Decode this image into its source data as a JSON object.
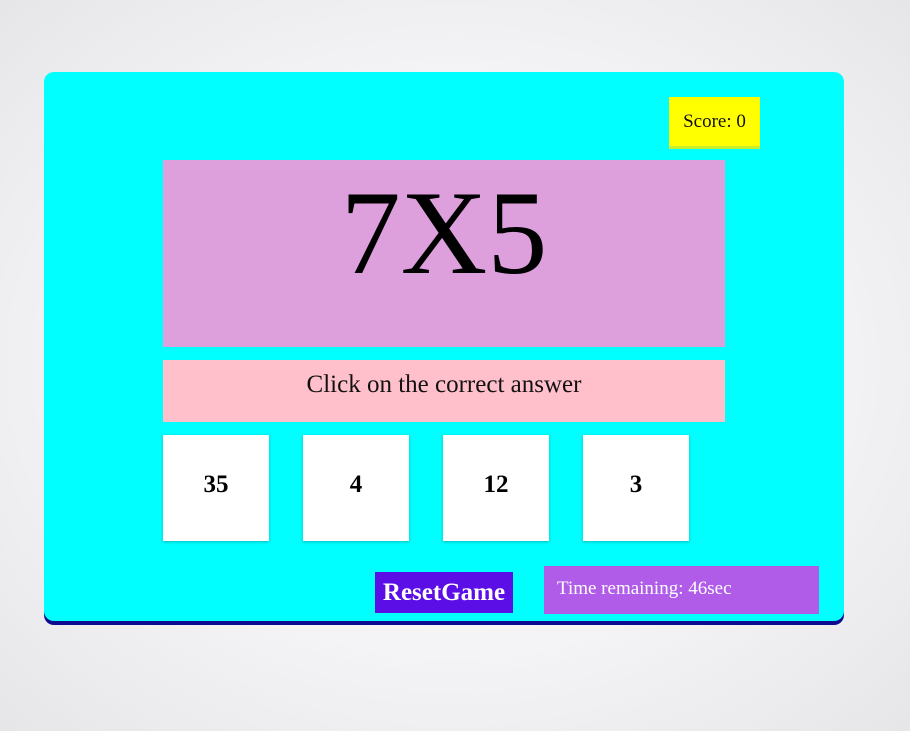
{
  "game": {
    "score_label": "Score: 0",
    "question": "7X5",
    "instruction": "Click on the correct answer",
    "choices": [
      "35",
      "4",
      "12",
      "3"
    ],
    "reset_label": "ResetGame",
    "timer_label": "Time remaining: 46sec"
  },
  "colors": {
    "container": "#00ffff",
    "score_box": "#ffff00",
    "question_box": "#dda0dd",
    "instruction_box": "#ffc0cb",
    "choice_box": "#ffffff",
    "reset_button": "#5b0ee5",
    "timer_box": "#b05ce8"
  }
}
